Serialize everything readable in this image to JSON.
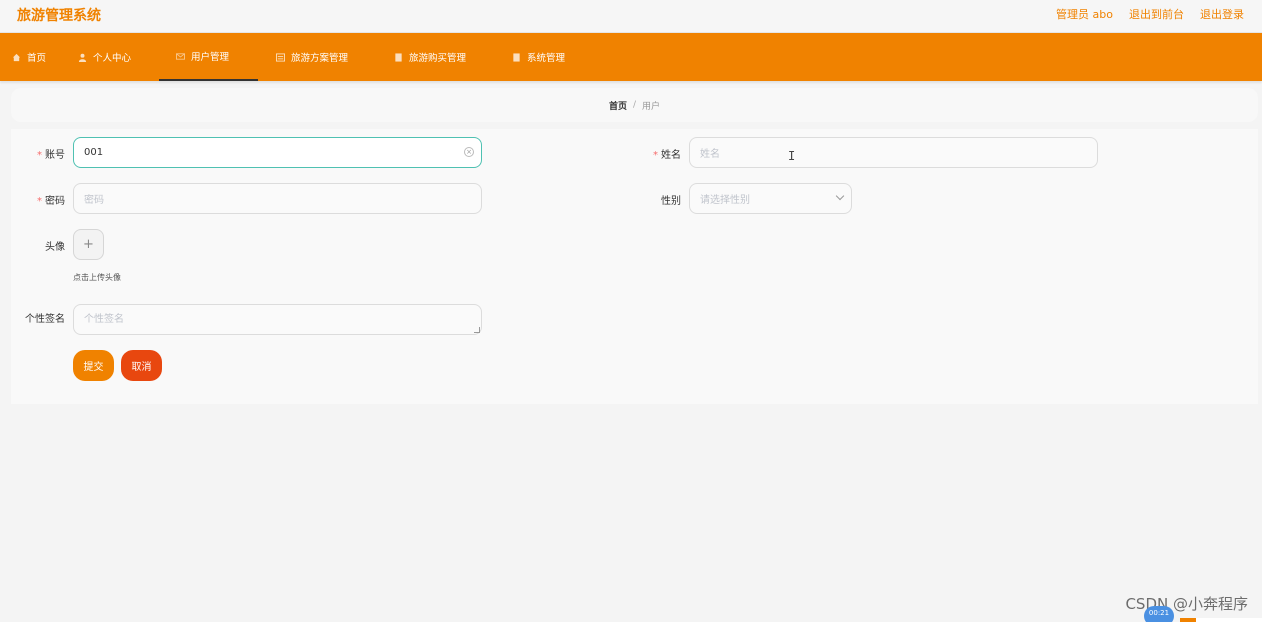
{
  "header": {
    "app_title": "旅游管理系统",
    "links": [
      "管理员 abo",
      "退出到前台",
      "退出登录"
    ]
  },
  "nav": {
    "items": [
      {
        "label": "首页",
        "icon": "home-icon"
      },
      {
        "label": "个人中心",
        "icon": "user-icon"
      },
      {
        "label": "用户管理",
        "icon": "mail-icon",
        "active": true
      },
      {
        "label": "旅游方案管理",
        "icon": "list-icon"
      },
      {
        "label": "旅游购买管理",
        "icon": "doc-icon"
      },
      {
        "label": "系统管理",
        "icon": "doc-icon"
      }
    ],
    "accent": "#f08200"
  },
  "breadcrumb": {
    "home": "首页",
    "separator": "/",
    "current": "用户"
  },
  "form": {
    "account_label": "账号",
    "account_value": "001",
    "name_label": "姓名",
    "name_placeholder": "姓名",
    "password_label": "密码",
    "password_placeholder": "密码",
    "gender_label": "性别",
    "gender_placeholder": "请选择性别",
    "avatar_label": "头像",
    "avatar_hint": "点击上传头像",
    "signature_label": "个性签名",
    "signature_placeholder": "个性签名",
    "required_mark": "*",
    "upload_symbol": "+"
  },
  "actions": {
    "submit_label": "提交",
    "cancel_label": "取消",
    "submit_color": "#f08200",
    "cancel_color": "#e8470f"
  },
  "overlay": {
    "watermark": "CSDN @小奔程序",
    "timer": "00:21",
    "cursor_glyph": "I"
  }
}
